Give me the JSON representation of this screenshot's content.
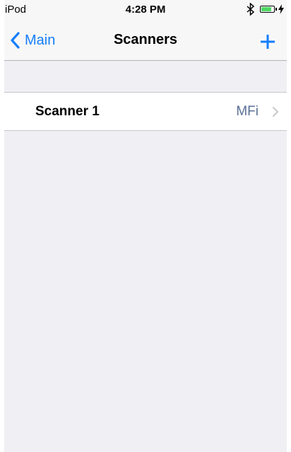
{
  "status_bar": {
    "carrier": "iPod",
    "time": "4:28 PM",
    "icons": [
      "bluetooth-icon",
      "battery-icon",
      "charging-icon"
    ],
    "battery_level": 0.85,
    "battery_color": "#4cd964"
  },
  "nav_bar": {
    "back_label": "Main",
    "title": "Scanners",
    "accent_color": "#157efb",
    "icons": [
      "chevron-left-icon",
      "plus-icon"
    ]
  },
  "scanner_list": {
    "items": [
      {
        "name": "Scanner 1",
        "detail": "MFi"
      }
    ]
  }
}
